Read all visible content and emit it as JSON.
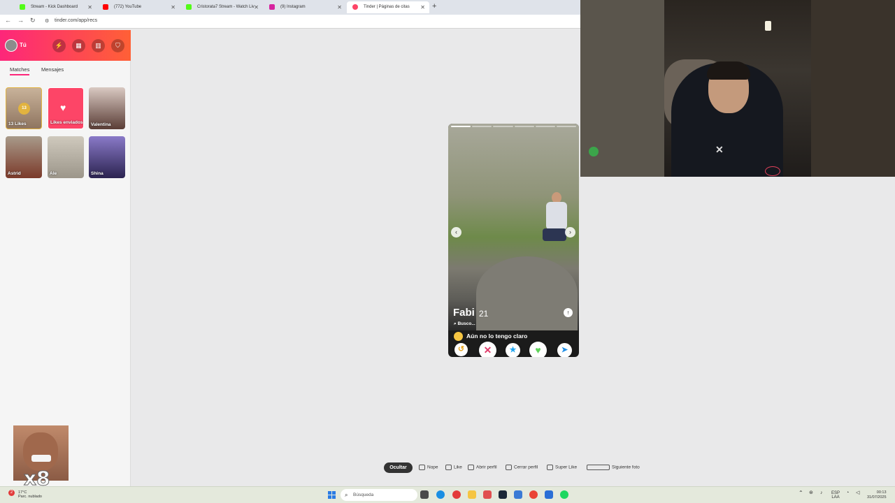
{
  "browser": {
    "tabs": [
      {
        "title": "Stream - Kick Dashboard",
        "favicon_color": "#53fc18"
      },
      {
        "title": "(772) YouTube",
        "favicon_color": "#ff0000"
      },
      {
        "title": "Cristorata7 Stream - Watch Liv",
        "favicon_color": "#53fc18"
      },
      {
        "title": "(9) Instagram",
        "favicon_color": "#d6249f"
      },
      {
        "title": "Tinder | Páginas de citas",
        "favicon_color": "#fd4567",
        "active": true
      }
    ],
    "new_tab": "+",
    "url": "tinder.com/app/recs"
  },
  "sidebar": {
    "user_label": "Tú",
    "header_icons": [
      "bolt-icon",
      "grid-icon",
      "briefcase-icon",
      "shield-icon"
    ],
    "tabs": [
      {
        "label": "Matches",
        "active": true
      },
      {
        "label": "Mensajes"
      }
    ],
    "cards": [
      {
        "label": "13 Likes",
        "badge": "13",
        "color": "#b69a7e"
      },
      {
        "label": "Likes enviados",
        "color": "#fd4567"
      },
      {
        "label": "Valentina",
        "color": "#7a5a52"
      },
      {
        "label": "Astrid",
        "color": "#7b4a3a"
      },
      {
        "label": "Ale",
        "color": "#bdb5a7"
      },
      {
        "label": "Shina",
        "color": "#5b4d9a"
      }
    ]
  },
  "overlay": {
    "emote_count": "x8"
  },
  "profile": {
    "name": "Fabi",
    "age": "21",
    "looking_label": "Busco...",
    "looking_value": "Aún no lo tengo claro",
    "photo_count": 6,
    "current_photo": 1,
    "actions": [
      {
        "name": "rewind",
        "glyph": "↺",
        "color": "#e6a21a"
      },
      {
        "name": "nope",
        "glyph": "✕",
        "color": "#e03a6a"
      },
      {
        "name": "super-like",
        "glyph": "★",
        "color": "#1fa5f0"
      },
      {
        "name": "like",
        "glyph": "♥",
        "color": "#5fd35a"
      },
      {
        "name": "boost",
        "glyph": "➤",
        "color": "#1f8ee6"
      }
    ]
  },
  "shortcuts": {
    "hide": "Ocultar",
    "items": [
      "Nope",
      "Like",
      "Abrir perfil",
      "Cerrar perfil",
      "Super Like",
      "Siguiente foto"
    ]
  },
  "taskbar": {
    "weather_temp": "17°C",
    "weather_desc": "Parc. nublado",
    "search_placeholder": "Búsqueda",
    "lang_top": "ESP",
    "lang_bottom": "LAA",
    "time": "00:13",
    "date": "31/07/2025",
    "notification_count": "2"
  }
}
